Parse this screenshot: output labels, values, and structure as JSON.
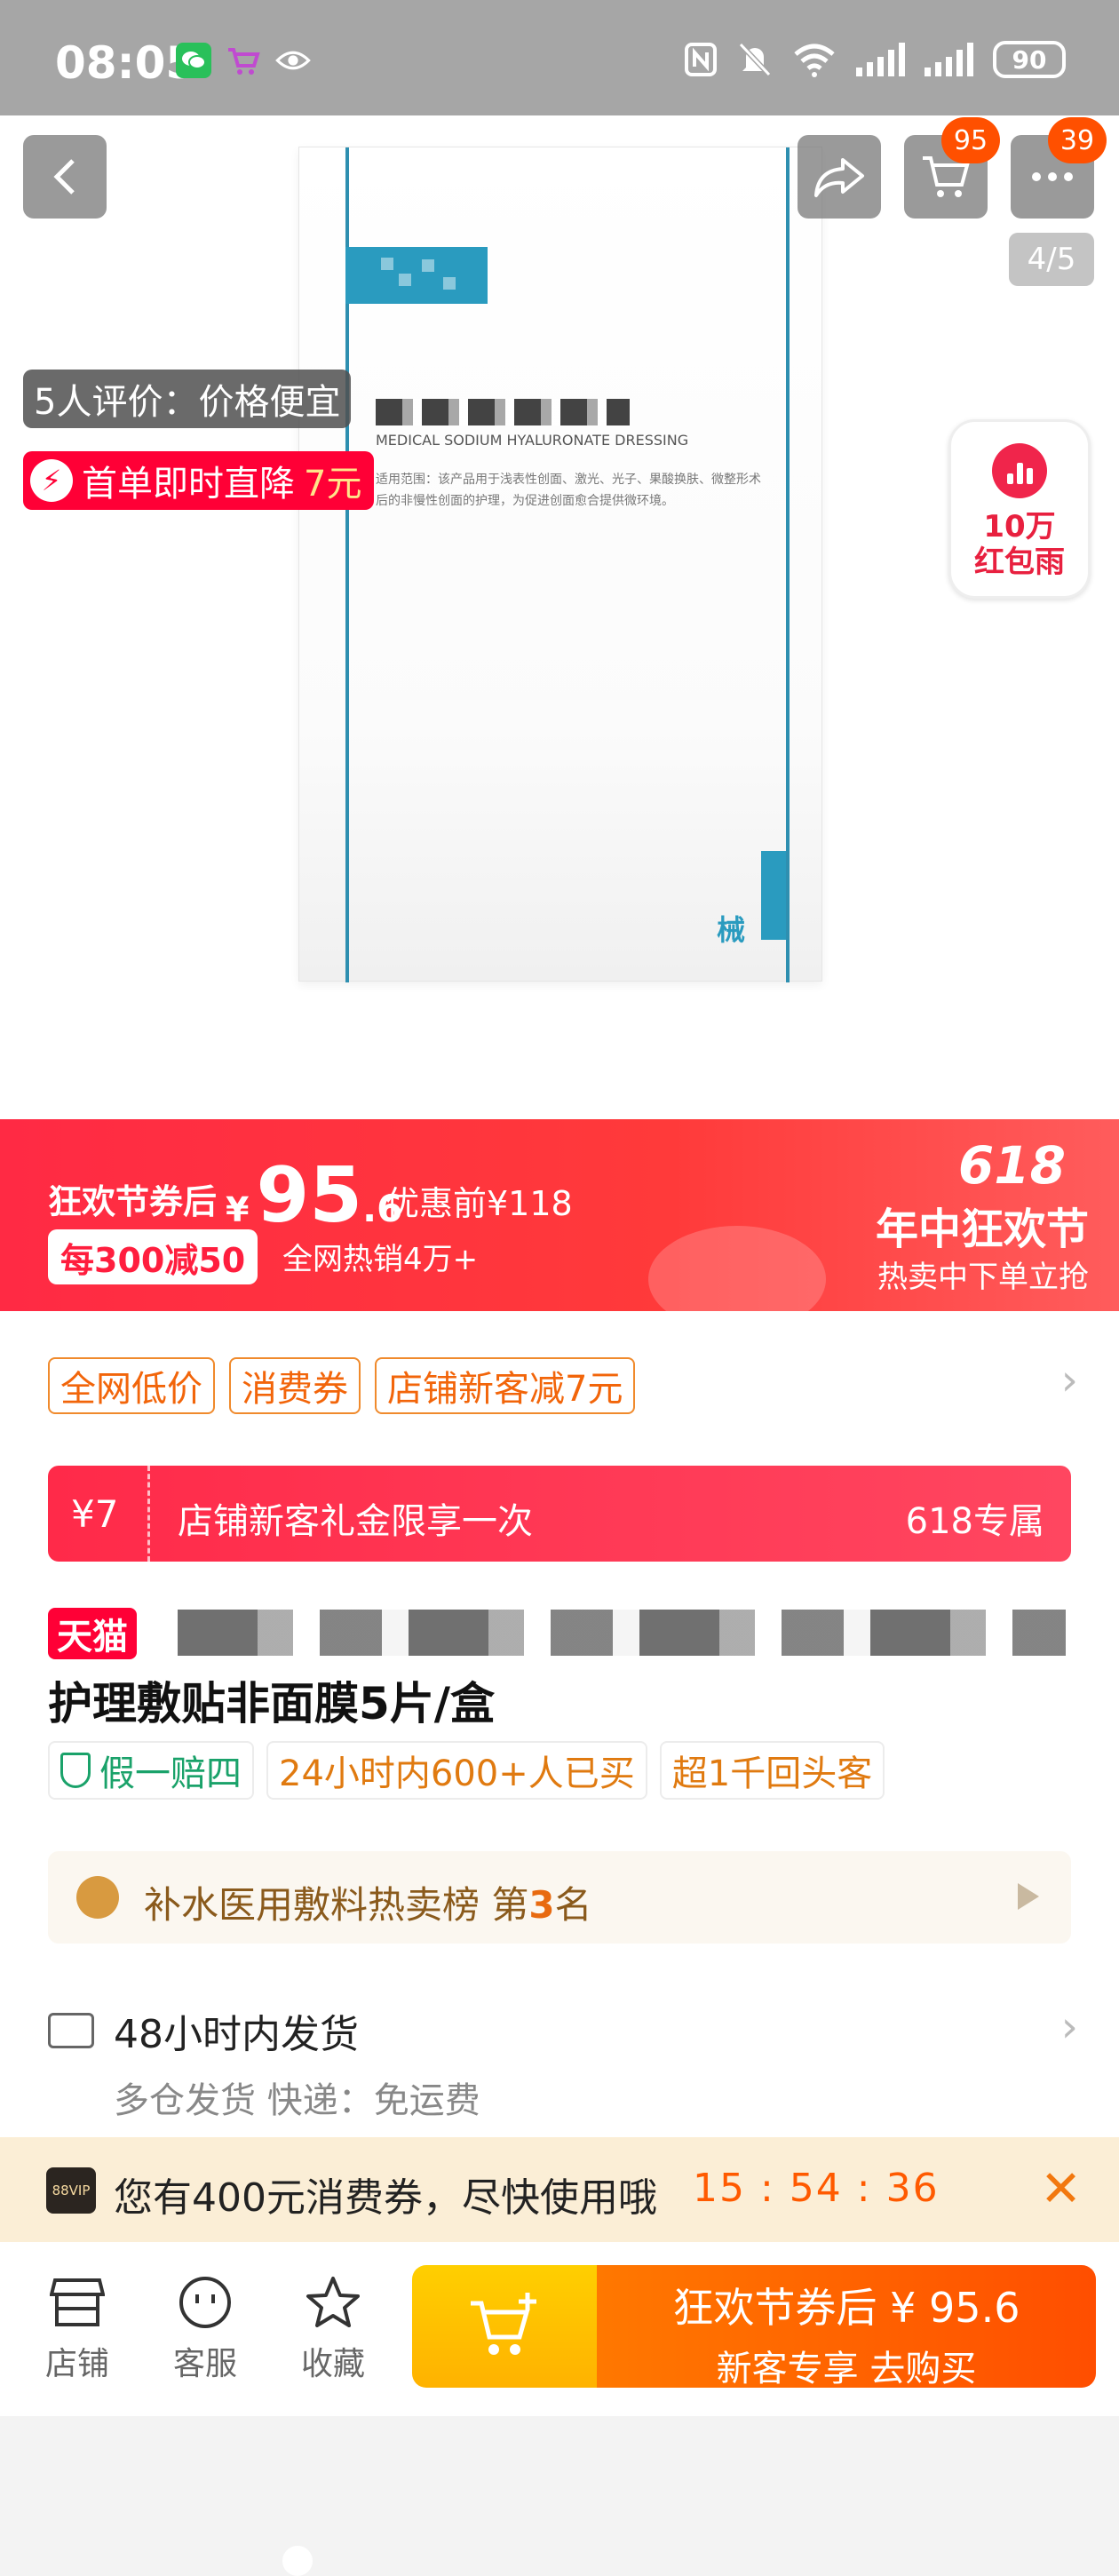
{
  "status_bar": {
    "time": "08:05",
    "battery": "90"
  },
  "gallery": {
    "cart_count": "95",
    "more_count": "39",
    "page_indicator": "4/5",
    "review_tag": "5人评价：价格便宜",
    "promo": {
      "text": "首单即时直降",
      "amount": "7元"
    },
    "red_envelope": {
      "line1": "10万",
      "line2": "红包雨"
    },
    "product_image": {
      "subtitle": "MEDICAL SODIUM HYALURONATE DRESSING",
      "usage_text": "适用范围：该产品用于浅表性创面、激光、光子、果酸换肤、微整形术后的非慢性创面的护理，为促进创面愈合提供微环境。",
      "corner_char": "械"
    }
  },
  "price_banner": {
    "label": "狂欢节券后",
    "currency": "¥",
    "price_int": "95",
    "price_dec": ".6",
    "original": "优惠前¥118",
    "discount": "每300减50",
    "sales": "全网热销4万+",
    "fest_num": "618",
    "fest_title": "年中狂欢节",
    "fest_sub": "热卖中下单立抢"
  },
  "coupons": {
    "tags": [
      "全网低价",
      "消费券",
      "店铺新客减7元"
    ],
    "card": {
      "amount": "¥7",
      "desc": "店铺新客礼金限享一次",
      "tag": "618专属"
    }
  },
  "product": {
    "store_tag": "天猫",
    "title": "护理敷贴非面膜5片/盒",
    "badges": [
      "假一赔四",
      "24小时内600+人已买",
      "超1千回头客"
    ]
  },
  "ranking": {
    "prefix": "补水医用敷料热卖榜  第",
    "number": "3",
    "suffix": "名"
  },
  "shipping": {
    "title": "48小时内发货",
    "sub": "多仓发货  快递：免运费"
  },
  "vip_bar": {
    "logo": "88VIP",
    "text": "您有400元消费券，尽快使用哦",
    "countdown": "15 : 54 : 36"
  },
  "bottom_nav": {
    "items": [
      "店铺",
      "客服",
      "收藏"
    ],
    "buy_line1": "狂欢节券后 ¥ 95.6",
    "buy_line2": "新客专享  去购买"
  }
}
